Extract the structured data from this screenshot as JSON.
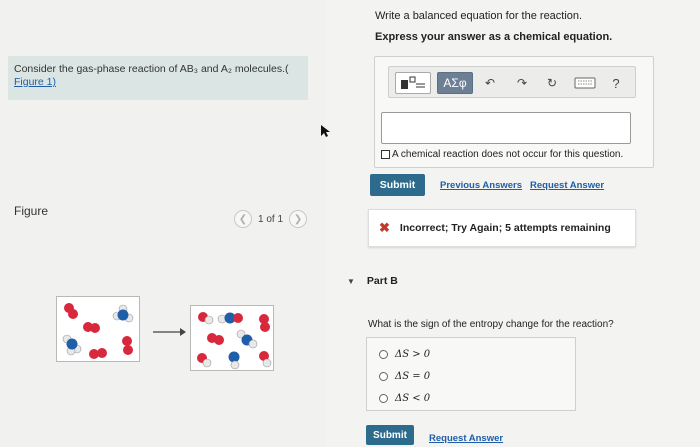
{
  "intro": {
    "text": "Consider the gas-phase reaction of AB₃ and A₂ molecules.(",
    "figure_link": "Figure 1)"
  },
  "figure": {
    "label": "Figure",
    "pager": {
      "text": "1 of 1",
      "prev_icon": "chevron-left-icon",
      "next_icon": "chevron-right-icon"
    }
  },
  "partA": {
    "instruction": "Write a balanced equation for the reaction.",
    "instruction_bold": "Express your answer as a chemical equation.",
    "toolbar": {
      "greek_label": "AΣφ",
      "help_label": "?"
    },
    "answer_value": "",
    "no_reaction_label": "A chemical reaction does not occur for this question.",
    "submit_label": "Submit",
    "previous_answers_label": "Previous Answers",
    "request_answer_label": "Request Answer",
    "feedback": "Incorrect; Try Again; 5 attempts remaining"
  },
  "partB": {
    "title": "Part B",
    "question": "What is the sign of the entropy change for the reaction?",
    "options": [
      "ΔS > 0",
      "ΔS = 0",
      "ΔS < 0"
    ],
    "submit_label": "Submit",
    "request_answer_label": "Request Answer"
  },
  "colors": {
    "accent": "#2d6b8d",
    "link": "#1f5ea8",
    "error": "#c0392b",
    "atom_red": "#d8283c",
    "atom_blue": "#1f5ea8",
    "atom_white": "#e8e8e8"
  }
}
